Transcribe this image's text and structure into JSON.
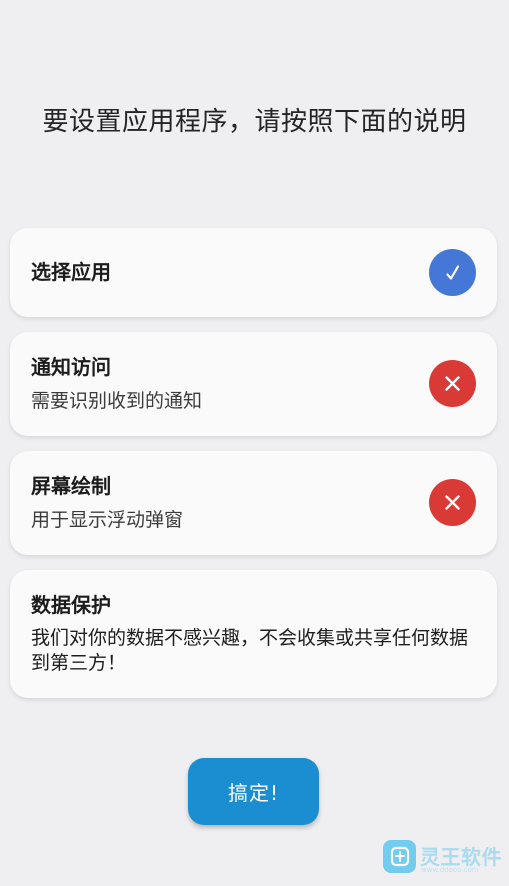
{
  "headline": "要设置应用程序，请按照下面的说明",
  "cards": [
    {
      "title": "选择应用",
      "status": "granted",
      "status_icon": "checkmark-icon",
      "status_color": "#4477d6"
    },
    {
      "title": "通知访问",
      "description": "需要识别收到的通知",
      "status": "denied",
      "status_icon": "close-icon",
      "status_color": "#d93a36"
    },
    {
      "title": "屏幕绘制",
      "description": "用于显示浮动弹窗",
      "status": "denied",
      "status_icon": "close-icon",
      "status_color": "#d93a36"
    },
    {
      "title": "数据保护",
      "description": "我们对你的数据不感兴趣，不会收集或共享任何数据到第三方！"
    }
  ],
  "done_button": "搞定!",
  "watermark": {
    "text": "灵王软件",
    "sub": "www.ddooo.com"
  }
}
